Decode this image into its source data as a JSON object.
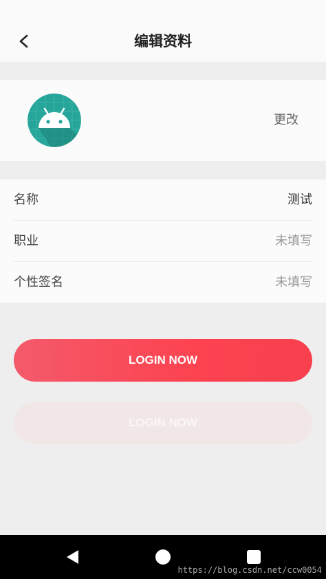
{
  "header": {
    "back_icon": "chevron-left-icon",
    "title": "编辑资料"
  },
  "avatar_section": {
    "avatar_icon": "android-robot-icon",
    "avatar_bg_color": "#26a69a",
    "change_label": "更改"
  },
  "profile_fields": [
    {
      "label": "名称",
      "value": "测试",
      "filled": true
    },
    {
      "label": "职业",
      "value": "未填写",
      "filled": false
    },
    {
      "label": "个性签名",
      "value": "未填写",
      "filled": false
    }
  ],
  "buttons": {
    "primary_label": "LOGIN NOW",
    "primary_color": "#fd4350",
    "disabled_label": "LOGIN NOW"
  },
  "navbar": {
    "back_icon": "triangle-back-icon",
    "home_icon": "circle-home-icon",
    "recent_icon": "square-recents-icon"
  },
  "watermark": "https://blog.csdn.net/ccw0054"
}
